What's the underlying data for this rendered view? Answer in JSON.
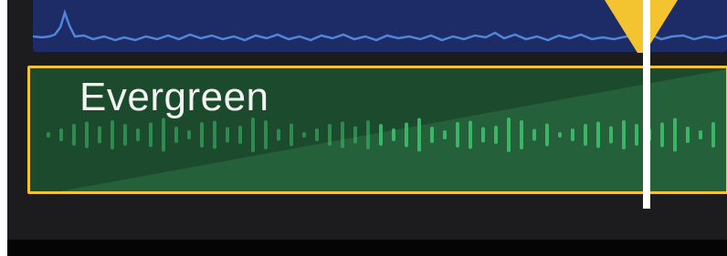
{
  "timeline": {
    "video_clip": {
      "color": "#1d2c66",
      "line_color": "#4f86d8"
    },
    "audio_clip": {
      "title": "Evergreen",
      "selected": true,
      "border_color": "#f4c430",
      "color": "#24603a",
      "waveform_color": "#3fbf6d"
    },
    "playhead": {
      "icon": "playhead-triangle-icon",
      "color": "#f4c430",
      "line_color": "#ffffff"
    }
  }
}
